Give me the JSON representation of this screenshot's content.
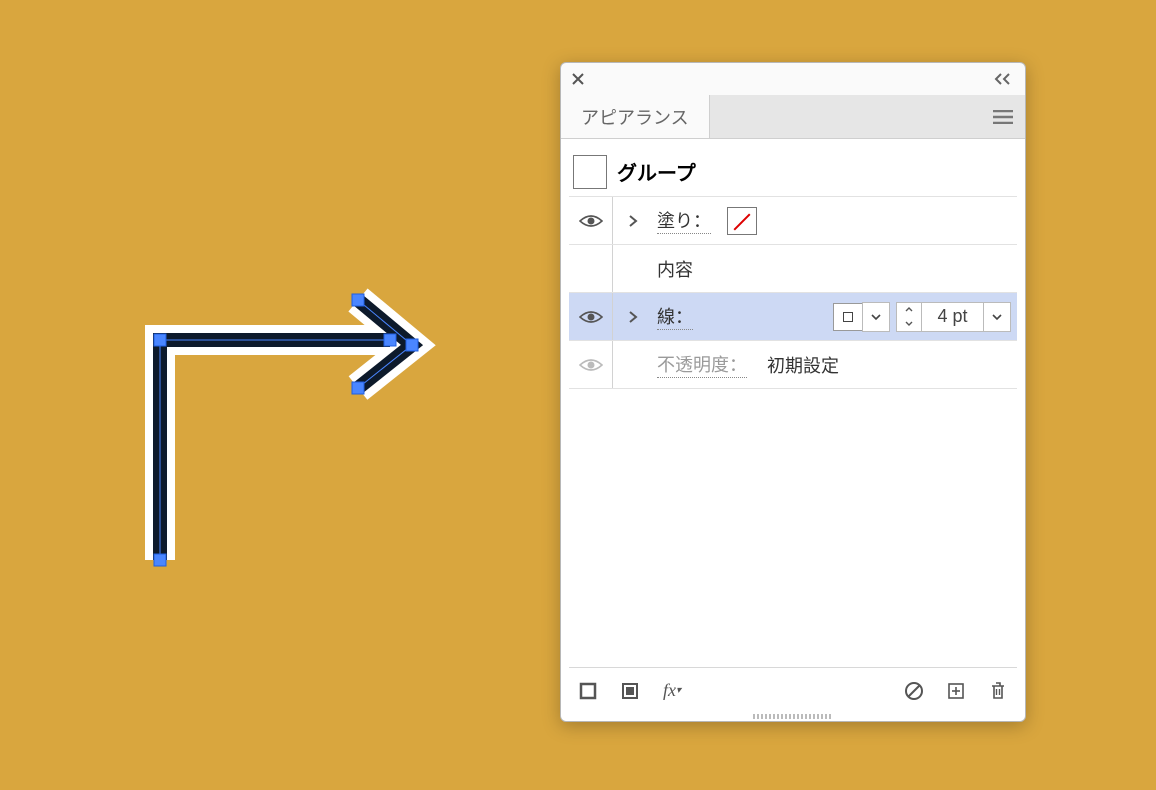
{
  "panel": {
    "tab_label": "アピアランス",
    "header_title": "グループ",
    "rows": {
      "fill": {
        "label": "塗り：",
        "swatch": "none"
      },
      "contents": {
        "label": "内容"
      },
      "stroke": {
        "label": "線：",
        "swatch": "hollow",
        "weight": "4 pt"
      },
      "opacity": {
        "label": "不透明度：",
        "value": "初期設定"
      }
    }
  },
  "icons": {
    "close": "×",
    "collapse": "‹‹",
    "menu": "≡",
    "chevron_right": "›",
    "eye": "eye"
  }
}
